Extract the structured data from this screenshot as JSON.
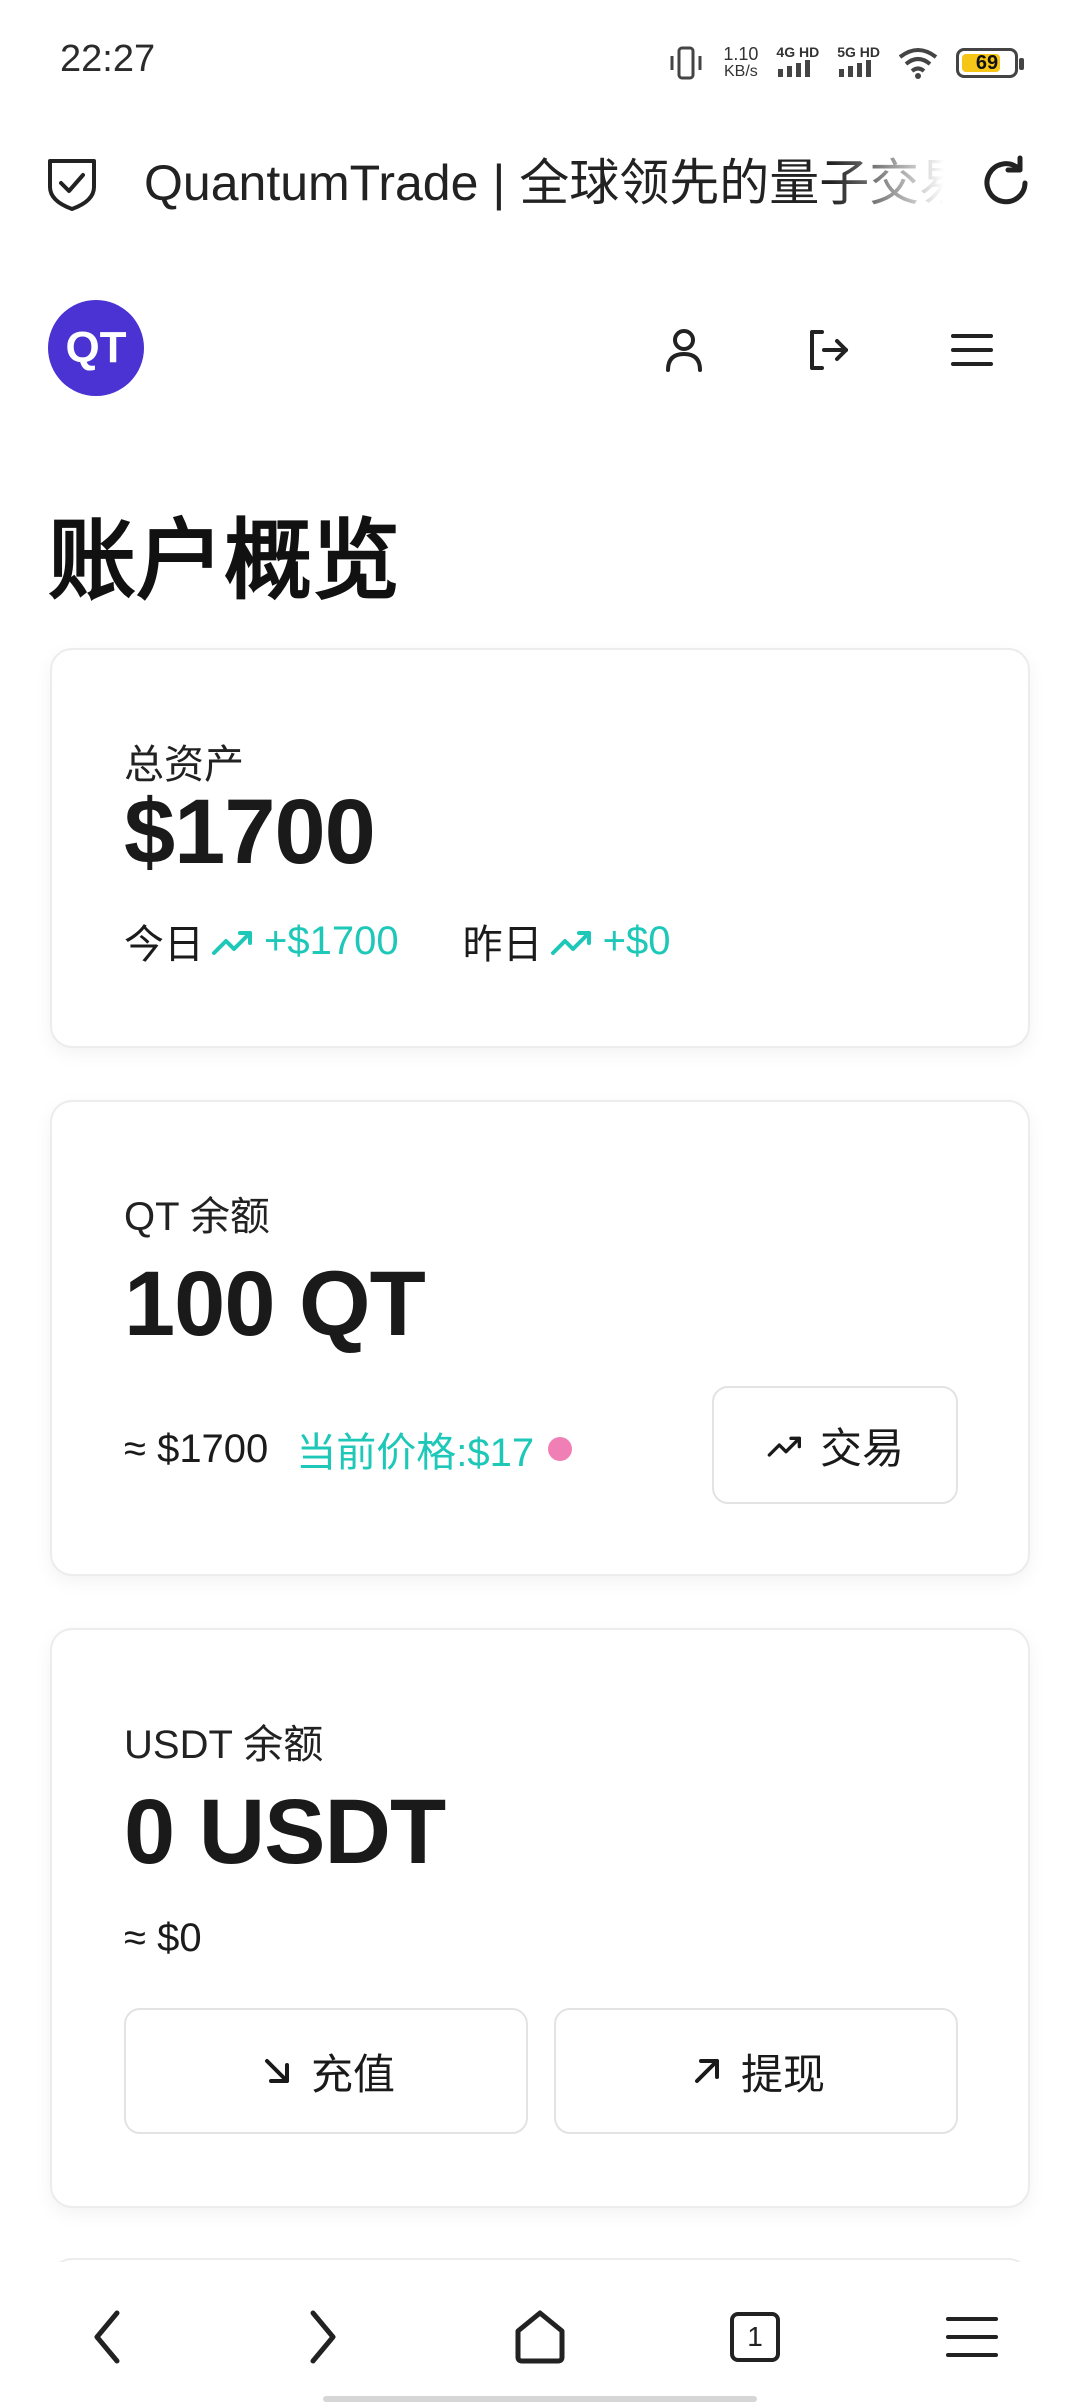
{
  "status_bar": {
    "time": "22:27",
    "speed_value": "1.10",
    "speed_unit": "KB/s",
    "net1": "4G HD",
    "net2": "5G HD",
    "battery": "69"
  },
  "browser": {
    "page_title": "QuantumTrade | 全球领先的量子交易平台",
    "icons": [
      "shield-check-icon",
      "reload-icon"
    ]
  },
  "header": {
    "logo_text": "QT",
    "icons": [
      "user-icon",
      "logout-icon",
      "menu-icon"
    ]
  },
  "main": {
    "title": "账户概览",
    "total_assets": {
      "label": "总资产",
      "value": "$1700",
      "today_label": "今日",
      "today_change": "+$1700",
      "yesterday_label": "昨日",
      "yesterday_change": "+$0"
    },
    "qt_balance": {
      "label": "QT 余额",
      "value": "100 QT",
      "approx": "≈ $1700",
      "price": "当前价格:$17",
      "trade_button": "交易"
    },
    "usdt_balance": {
      "label": "USDT 余额",
      "value": "0 USDT",
      "approx": "≈ $0",
      "deposit_button": "充值",
      "withdraw_button": "提现"
    }
  },
  "bottom_nav": {
    "tab_count": "1",
    "icons": [
      "back-icon",
      "forward-icon",
      "home-icon",
      "tabs-icon",
      "menu-icon"
    ]
  },
  "colors": {
    "brand": "#4a32d3",
    "positive": "#1ec8b8",
    "live_dot": "#f07fb6"
  }
}
